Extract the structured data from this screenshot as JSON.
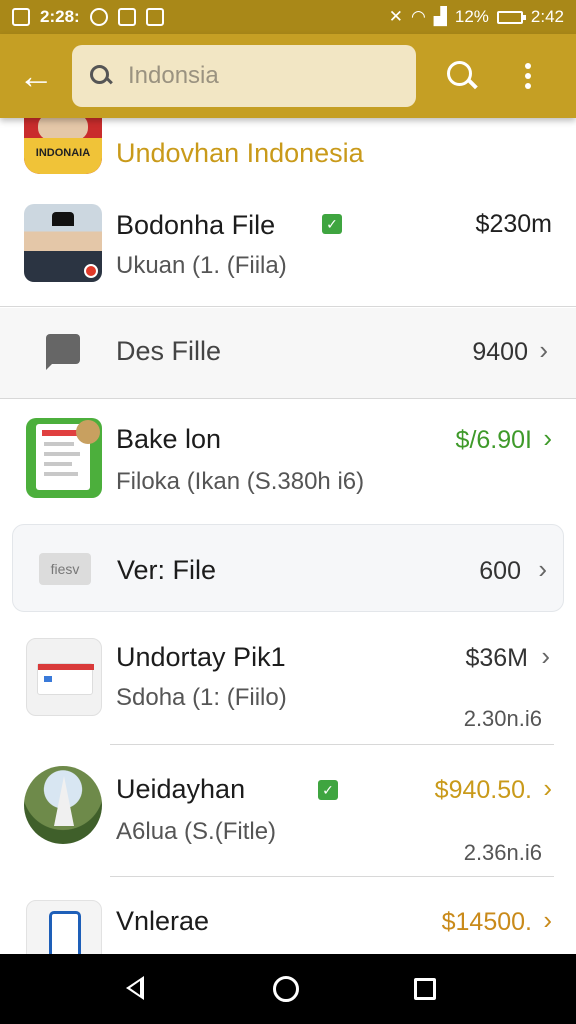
{
  "status_bar": {
    "left_time": "2:28:",
    "battery_percent": "12%",
    "right_time": "2:42"
  },
  "app_bar": {
    "search_value": "Indonsia"
  },
  "header": {
    "badge_text": "INDONAIA",
    "title": "Undovhan Indonesia"
  },
  "items": [
    {
      "title": "Bodonha File",
      "subtitle": "Ukuan (1. (Fiila)",
      "price": "$230m",
      "verified": true,
      "price_color": "#202020"
    },
    {
      "title": "Des Fille",
      "price": "9400",
      "price_color": "#333333"
    },
    {
      "title": "Bake lon",
      "subtitle": "Filoka (Ikan (S.380h i6)",
      "price": "$/6.90I",
      "price_color": "#3f9a2a"
    },
    {
      "title": "Ver: File",
      "price": "600",
      "thumb_text": "fiesv",
      "price_color": "#333333"
    },
    {
      "title": "Undortay Pik1",
      "subtitle": "Sdoha (1: (Fiilo)",
      "price": "$36M",
      "meta": "2.30n.i6",
      "price_color": "#333333"
    },
    {
      "title": "Ueidayhan",
      "subtitle": "A6lua (S.(Fitle)",
      "price": "$940.50.",
      "meta": "2.36n.i6",
      "verified": true,
      "price_color": "#c99a1a"
    },
    {
      "title": "Vnlerae",
      "price": "$14500.",
      "price_color": "#c98a1a"
    }
  ],
  "colors": {
    "status_bar": "#a98818",
    "app_bar": "#c59f24",
    "accent_gold": "#c99a1a",
    "green": "#3fa540"
  },
  "icons": {
    "back": "arrow-left-icon",
    "search": "search-icon",
    "more": "more-vert-icon",
    "chevron": "chevron-right-icon"
  }
}
